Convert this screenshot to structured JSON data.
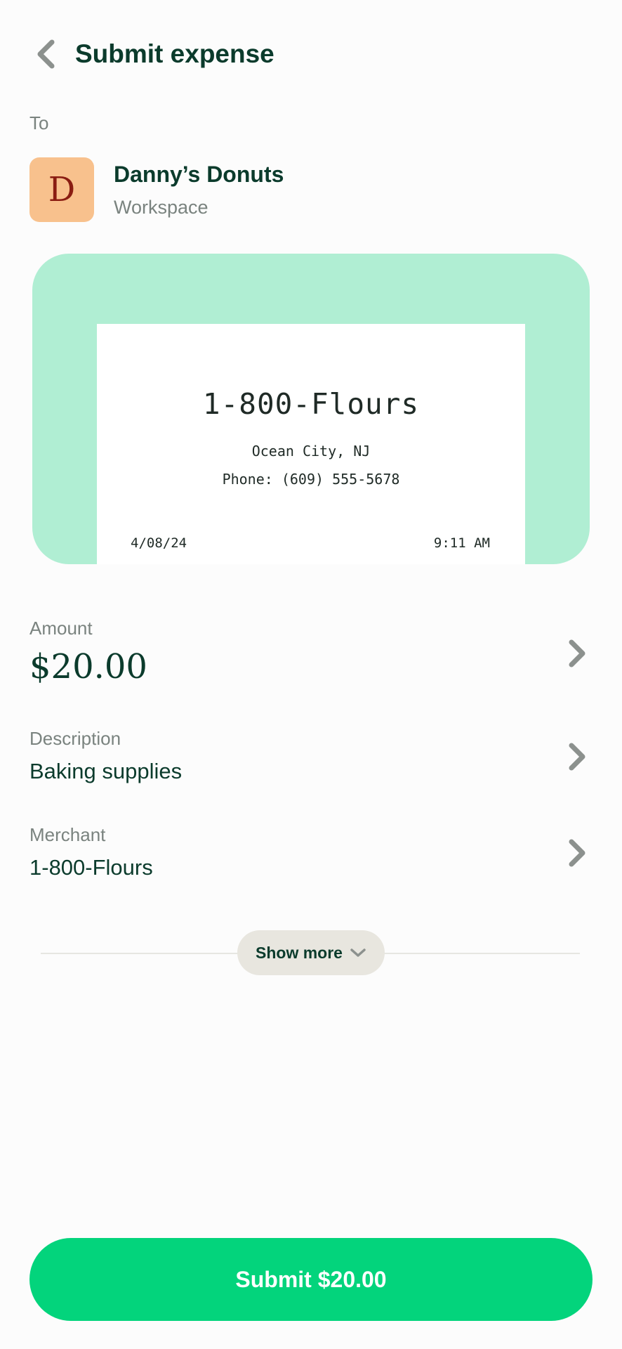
{
  "header": {
    "title": "Submit expense",
    "back_icon": "chevron-left-icon"
  },
  "recipient": {
    "label": "To",
    "avatar_letter": "D",
    "name": "Danny’s Donuts",
    "type": "Workspace",
    "avatar_color": "#f8c18d"
  },
  "receipt": {
    "merchant": "1-800-Flours",
    "city": "Ocean City, NJ",
    "phone": "Phone: (609) 555-5678",
    "date": "4/08/24",
    "time": "9:11 AM",
    "background_color": "#b0eed3"
  },
  "fields": {
    "amount": {
      "label": "Amount",
      "value": "$20.00"
    },
    "description": {
      "label": "Description",
      "value": "Baking supplies"
    },
    "merchant": {
      "label": "Merchant",
      "value": "1-800-Flours"
    }
  },
  "show_more": {
    "label": "Show more",
    "icon": "chevron-down-icon"
  },
  "submit": {
    "label": "Submit $20.00",
    "color": "#03d47c"
  }
}
